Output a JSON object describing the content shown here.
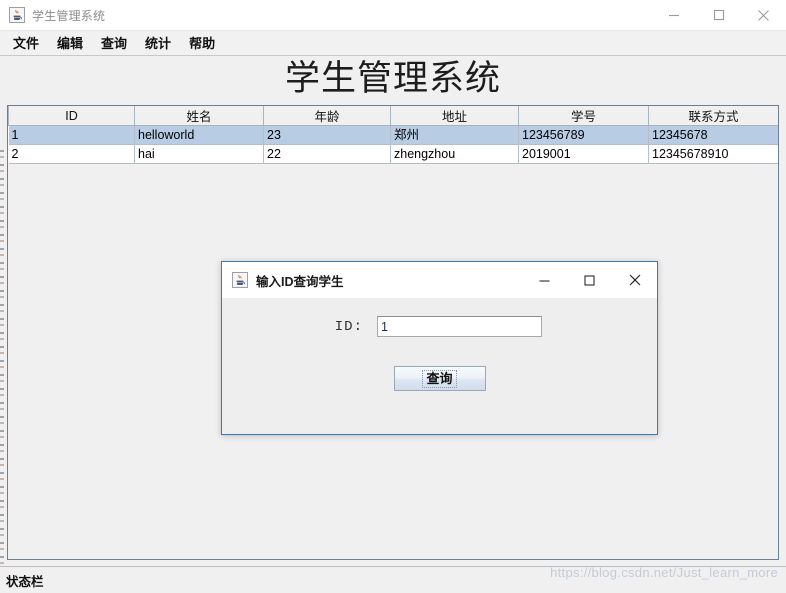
{
  "window": {
    "title": "学生管理系统",
    "icon": "java-coffee-cup-icon",
    "controls": {
      "minimize": "minimize-icon",
      "maximize": "maximize-icon",
      "close": "close-icon"
    }
  },
  "menubar": {
    "items": [
      {
        "label": "文件"
      },
      {
        "label": "编辑"
      },
      {
        "label": "查询"
      },
      {
        "label": "统计"
      },
      {
        "label": "帮助"
      }
    ]
  },
  "heading": {
    "title": "学生管理系统"
  },
  "table": {
    "columns": [
      "ID",
      "姓名",
      "年龄",
      "地址",
      "学号",
      "联系方式"
    ],
    "rows": [
      {
        "selected": true,
        "cells": [
          "1",
          "helloworld",
          "23",
          "郑州",
          "123456789",
          "12345678"
        ]
      },
      {
        "selected": false,
        "cells": [
          "2",
          "hai",
          "22",
          "zhengzhou",
          "2019001",
          "12345678910"
        ]
      }
    ]
  },
  "statusbar": {
    "text": "状态栏"
  },
  "watermark": {
    "text": "https://blog.csdn.net/Just_learn_more"
  },
  "dialog": {
    "title": "输入ID查询学生",
    "icon": "java-coffee-cup-icon",
    "controls": {
      "minimize": "minimize-icon",
      "maximize": "maximize-icon",
      "close": "close-icon"
    },
    "field": {
      "label": "ID:",
      "value": "1",
      "placeholder": ""
    },
    "submit_label": "查询"
  },
  "colors": {
    "selection": "#b8cce4",
    "dialog_border": "#3b79b8",
    "panel_bg": "#f0f0f0",
    "watermark": "#c3ccd6"
  }
}
